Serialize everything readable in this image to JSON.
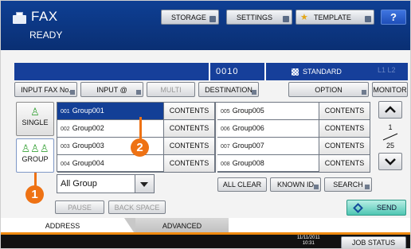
{
  "header": {
    "title": "FAX",
    "status": "READY",
    "storage_label": "STORAGE",
    "settings_label": "SETTINGS",
    "template_label": "TEMPLATE",
    "help_label": "?"
  },
  "status_bar": {
    "count": "0010",
    "quality": "STANDARD",
    "line_indicator": "L1 L2"
  },
  "toolbar": {
    "input_fax_label": "INPUT FAX No.",
    "input_at_label": "INPUT @",
    "multi_label": "MULTI",
    "destination_label": "DESTINATION",
    "option_label": "OPTION",
    "monitor_label": "MONITOR"
  },
  "side_tabs": {
    "single_label": "SINGLE",
    "group_label": "GROUP"
  },
  "groups": [
    {
      "num": "001",
      "name": "Group001",
      "contents": "CONTENTS"
    },
    {
      "num": "002",
      "name": "Group002",
      "contents": "CONTENTS"
    },
    {
      "num": "003",
      "name": "Group003",
      "contents": "CONTENTS"
    },
    {
      "num": "004",
      "name": "Group004",
      "contents": "CONTENTS"
    },
    {
      "num": "005",
      "name": "Group005",
      "contents": "CONTENTS"
    },
    {
      "num": "006",
      "name": "Group006",
      "contents": "CONTENTS"
    },
    {
      "num": "007",
      "name": "Group007",
      "contents": "CONTENTS"
    },
    {
      "num": "008",
      "name": "Group008",
      "contents": "CONTENTS"
    }
  ],
  "pagination": {
    "current": "1",
    "total": "25"
  },
  "filter": {
    "selected": "All Group"
  },
  "actions": {
    "all_clear_label": "ALL CLEAR",
    "known_id_label": "KNOWN ID",
    "search_label": "SEARCH",
    "pause_label": "PAUSE",
    "backspace_label": "BACK SPACE",
    "send_label": "SEND"
  },
  "tabs": {
    "address_label": "ADDRESS",
    "advanced_label": "ADVANCED"
  },
  "footer": {
    "date": "11/11/2011",
    "time": "10:31",
    "job_status_label": "JOB STATUS"
  },
  "callouts": {
    "one": "1",
    "two": "2"
  },
  "colors": {
    "header_blue": "#0e3f94",
    "selected_row": "#133f96",
    "callout_orange": "#ee7214",
    "send_teal": "#4fc6b3"
  }
}
